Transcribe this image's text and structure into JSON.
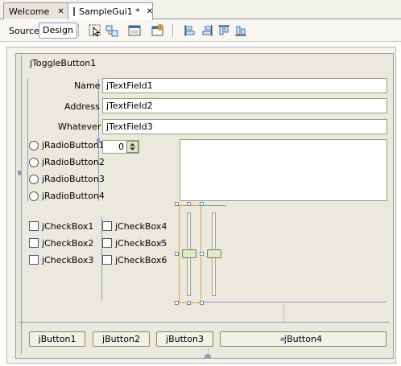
{
  "tabs": [
    {
      "label": "Welcome",
      "active": false
    },
    {
      "label": "SampleGui1 *",
      "active": true
    }
  ],
  "toolbar": {
    "source_label": "Source",
    "design_label": "Design"
  },
  "form": {
    "toggle_button": "jToggleButton1",
    "fields": [
      {
        "label": "Name",
        "value": "jTextField1"
      },
      {
        "label": "Address",
        "value": "jTextField2"
      },
      {
        "label": "Whatever",
        "value": "jTextField3"
      }
    ],
    "radios": [
      "jRadioButton1",
      "jRadioButton2",
      "jRadioButton3",
      "jRadioButton4"
    ],
    "spinner_value": "0",
    "checkboxes": [
      "jCheckBox1",
      "jCheckBox2",
      "jCheckBox3",
      "jCheckBox4",
      "jCheckBox5",
      "jCheckBox6"
    ],
    "buttons": [
      "jButton1",
      "jButton2",
      "jButton3",
      "jButton4"
    ]
  },
  "colors": {
    "accent_selection": "#e0a040",
    "guide": "#8aa0b8"
  }
}
